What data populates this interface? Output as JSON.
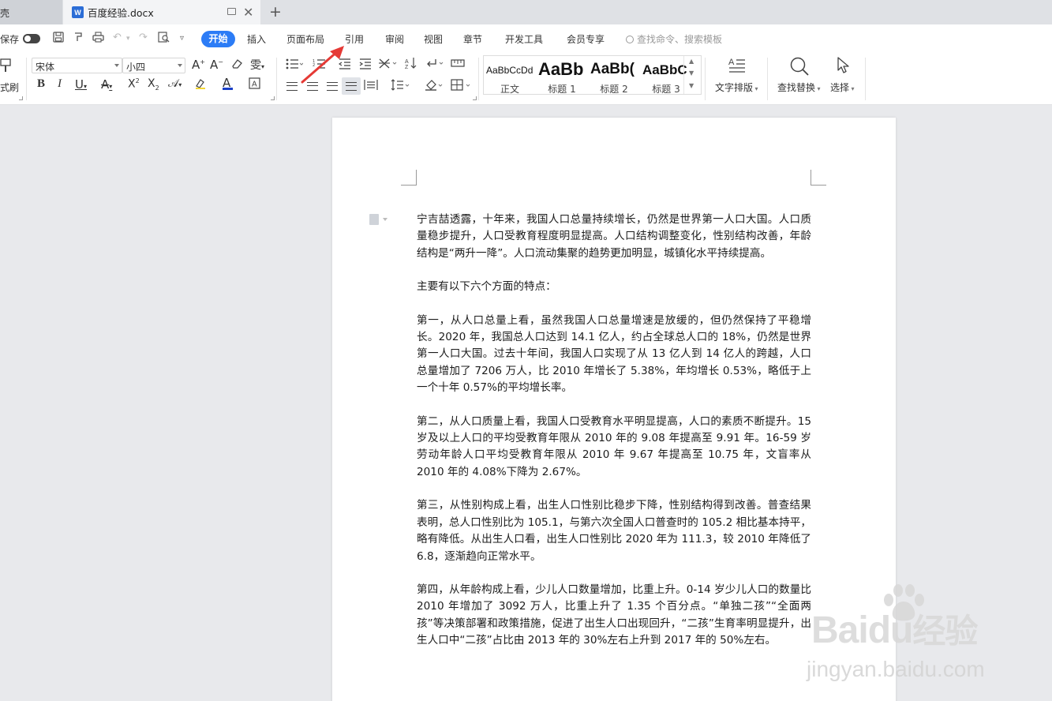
{
  "tabs": {
    "home_partial": "壳",
    "doc_title": "百度经验.docx",
    "doc_icon_letter": "W",
    "add_symbol": "+"
  },
  "quickbar": {
    "autosave_label": "保存"
  },
  "menu": {
    "start": "开始",
    "insert": "插入",
    "page_layout": "页面布局",
    "references": "引用",
    "review": "审阅",
    "view": "视图",
    "chapter": "章节",
    "developer": "开发工具",
    "member": "会员专享",
    "search_placeholder": "查找命令、搜索模板"
  },
  "ribbon": {
    "format_painter_partial": "式刷",
    "font_name": "宋体",
    "font_size": "小四",
    "styles": [
      {
        "preview": "AaBbCcDd",
        "name": "正文"
      },
      {
        "preview": "AaBb",
        "name": "标题 1"
      },
      {
        "preview": "AaBb(",
        "name": "标题 2"
      },
      {
        "preview": "AaBbC",
        "name": "标题 3"
      }
    ],
    "text_layout": "文字排版",
    "find_replace": "查找替换",
    "select": "选择"
  },
  "document": {
    "paragraphs": [
      "宁吉喆透露，十年来，我国人口总量持续增长，仍然是世界第一人口大国。人口质量稳步提升，人口受教育程度明显提高。人口结构调整变化，性别结构改善，年龄结构是“两升一降”。人口流动集聚的趋势更加明显，城镇化水平持续提高。",
      "主要有以下六个方面的特点：",
      "第一，从人口总量上看，虽然我国人口总量增速是放缓的，但仍然保持了平稳增长。2020 年，我国总人口达到 14.1 亿人，约占全球总人口的 18%，仍然是世界第一人口大国。过去十年间，我国人口实现了从 13 亿人到 14 亿人的跨越，人口总量增加了 7206 万人，比 2010 年增长了 5.38%，年均增长 0.53%，略低于上一个十年 0.57%的平均增长率。",
      "第二，从人口质量上看，我国人口受教育水平明显提高，人口的素质不断提升。15 岁及以上人口的平均受教育年限从 2010 年的 9.08 年提高至 9.91 年。16-59 岁劳动年龄人口平均受教育年限从 2010 年 9.67 年提高至 10.75 年，文盲率从 2010 年的 4.08%下降为 2.67%。",
      "第三，从性别构成上看，出生人口性别比稳步下降，性别结构得到改善。普查结果表明，总人口性别比为 105.1，与第六次全国人口普查时的 105.2 相比基本持平，略有降低。从出生人口看，出生人口性别比 2020 年为 111.3，较 2010 年降低了 6.8，逐渐趋向正常水平。",
      "第四，从年龄构成上看，少儿人口数量增加，比重上升。0-14 岁少儿人口的数量比 2010 年增加了 3092 万人，比重上升了 1.35 个百分点。“单独二孩”“全面两孩”等决策部署和政策措施，促进了出生人口出现回升，“二孩”生育率明显提升，出生人口中“二孩”占比由 2013 年的 30%左右上升到 2017 年的 50%左右。"
    ]
  },
  "watermark": {
    "brand_latin": "Bai",
    "brand_du": "du",
    "brand_cn": "经验",
    "url": "jingyan.baidu.com"
  },
  "colors": {
    "accent": "#2c7cf6",
    "arrow": "#e53935"
  }
}
